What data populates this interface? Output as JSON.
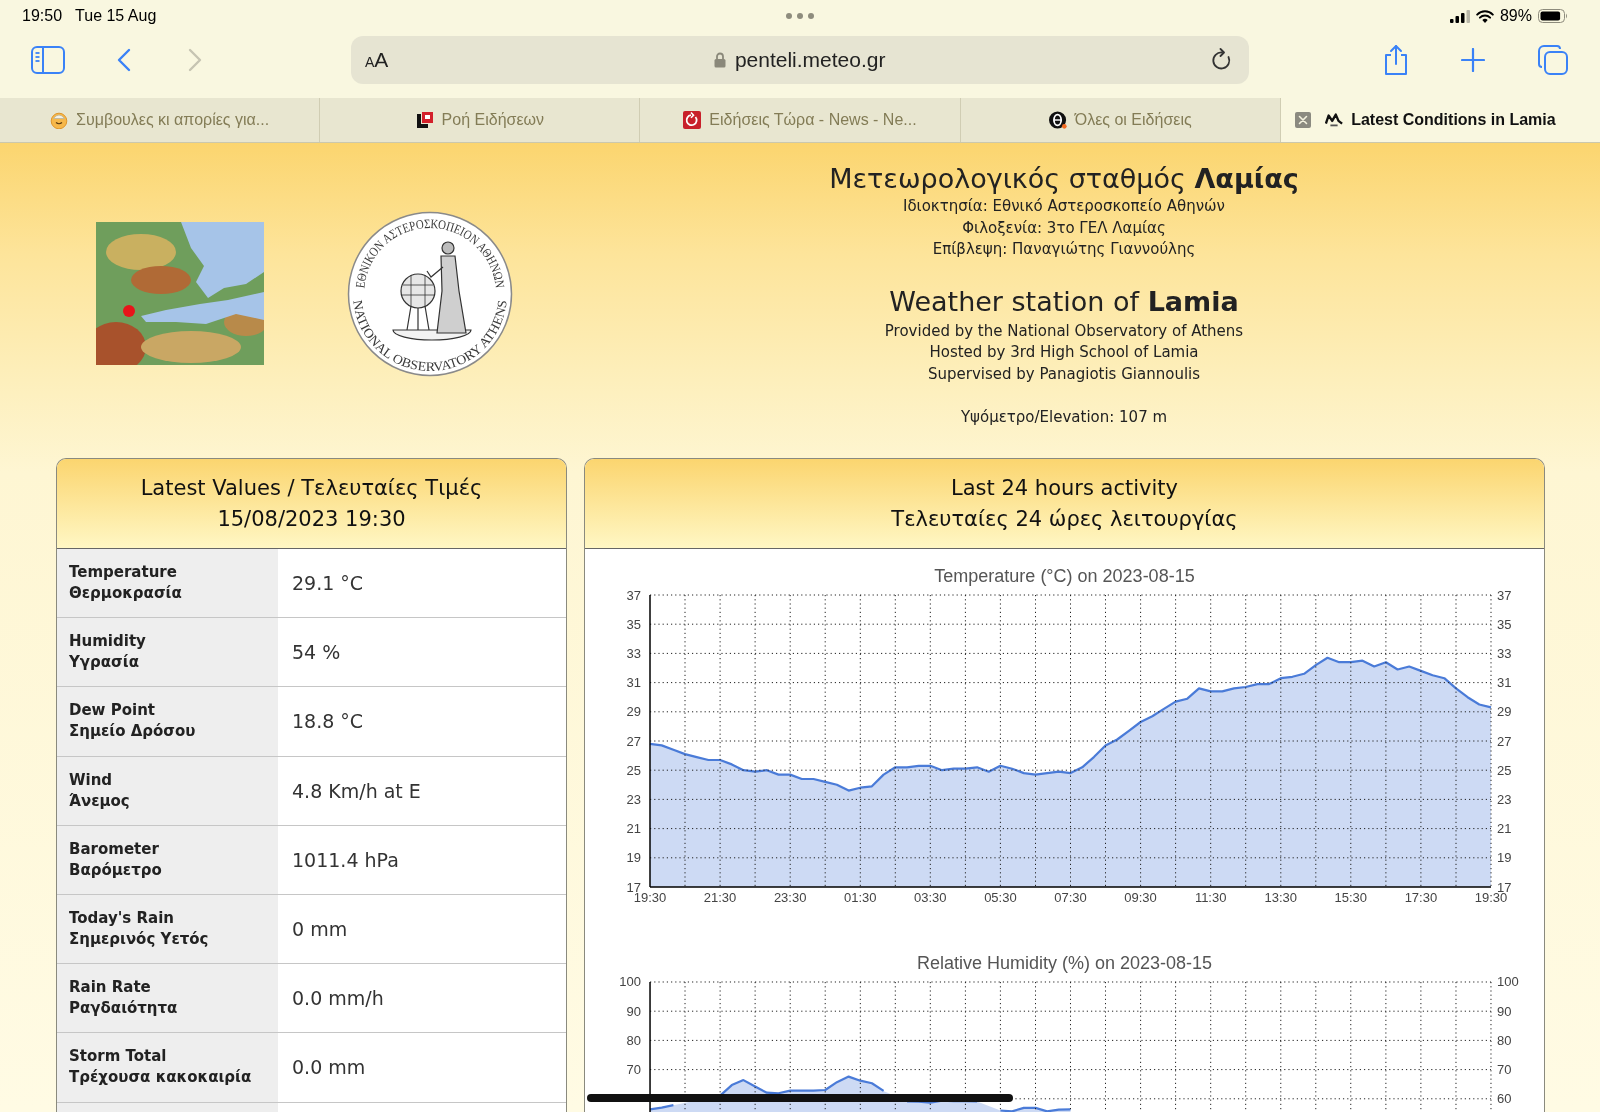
{
  "status_bar": {
    "time": "19:50",
    "date": "Tue 15 Aug",
    "battery": "89%"
  },
  "toolbar": {
    "back": {
      "disabled": false
    },
    "forward": {
      "disabled": true
    },
    "address": {
      "text_size": "AA",
      "url": "penteli.meteo.gr"
    }
  },
  "tabs": [
    {
      "kind": "smiley",
      "title": "Συμβουλες κι απορίες για...",
      "selected": false
    },
    {
      "kind": "block",
      "title": "Ροή Ειδήσεων",
      "selected": false
    },
    {
      "kind": "square",
      "title": "Ειδήσεις Τώρα - News - Ne...",
      "selected": false
    },
    {
      "kind": "circle",
      "title": "Όλες οι Ειδήσεις",
      "selected": false
    },
    {
      "kind": "zigzag",
      "title": "Latest Conditions in Lamia",
      "selected": true
    }
  ],
  "header": {
    "logo": {
      "top_text": "ΕΘΝΙΚΟΝ ΑΣΤΕΡΟΣΚΟΠΕΙΟΝ ΑΘΗΝΩΝ",
      "bottom_text": "NATIONAL OBSERVATORY ATHENS"
    },
    "greek": {
      "title": "Μετεωρολογικός σταθμός **Λαμίας**",
      "lines": [
        "Ιδιοκτησία: Εθνικό Αστεροσκοπείο Αθηνών",
        "Φιλοξενία: 3το ΓΕΛ Λαμίας",
        "Επίβλεψη: Παναγιώτης Γιαννούλης"
      ]
    },
    "english": {
      "title": "Weather station of **Lamia**",
      "lines": [
        "Provided by the National Observatory of Athens",
        "Hosted by 3rd High School of Lamia",
        "Supervised by Panagiotis Giannoulis"
      ]
    },
    "elevation": "Υψόμετρο/Elevation: 107 m"
  },
  "latest_values": {
    "title": "Latest Values / Τελευταίες Τιμές",
    "timestamp": "15/08/2023 19:30",
    "rows": [
      {
        "label": "Temperature",
        "label_gr": "Θερμοκρασία",
        "value": "29.1 °C"
      },
      {
        "label": "Humidity",
        "label_gr": "Υγρασία",
        "value": "54 %"
      },
      {
        "label": "Dew Point",
        "label_gr": "Σημείο Δρόσου",
        "value": "18.8 °C"
      },
      {
        "label": "Wind",
        "label_gr": "Άνεμος",
        "value": "4.8 Km/h at E"
      },
      {
        "label": "Barometer",
        "label_gr": "Βαρόμετρο",
        "value": "1011.4 hPa"
      },
      {
        "label": "Today's Rain",
        "label_gr": "Σημερινός Υετός",
        "value": "0 mm"
      },
      {
        "label": "Rain Rate",
        "label_gr": "Ραγδαιότητα",
        "value": "0.0 mm/h"
      },
      {
        "label": "Storm Total",
        "label_gr": "Τρέχουσα κακοκαιρία",
        "value": "0.0 mm"
      }
    ]
  },
  "activity": {
    "title": "Last 24 hours activity",
    "title_gr": "Τελευταίες 24 ώρες λειτουργίας",
    "charts": [
      {
        "chart_data": {
          "type": "area",
          "title": "Temperature (°C) on 2023-08-15",
          "categories": [
            "19:30",
            null,
            null,
            null,
            null,
            null,
            "21:30",
            null,
            null,
            null,
            null,
            null,
            "23:30",
            null,
            null,
            null,
            null,
            null,
            "01:30",
            null,
            null,
            null,
            null,
            null,
            "03:30",
            null,
            null,
            null,
            null,
            null,
            "05:30",
            null,
            null,
            null,
            null,
            null,
            "07:30",
            null,
            null,
            null,
            null,
            null,
            "09:30",
            null,
            null,
            null,
            null,
            null,
            "11:30",
            null,
            null,
            null,
            null,
            null,
            "13:30",
            null,
            null,
            null,
            null,
            null,
            "15:30",
            null,
            null,
            null,
            null,
            null,
            "17:30",
            null,
            null,
            null,
            null,
            null,
            "19:30"
          ],
          "series": [
            {
              "color": "#4a7bd8",
              "values": [
                26.8,
                26.7,
                26.4,
                26.1,
                25.9,
                25.7,
                25.7,
                25.4,
                25.0,
                24.9,
                25.0,
                24.7,
                24.7,
                24.4,
                24.4,
                24.2,
                24.0,
                23.6,
                23.8,
                23.9,
                24.7,
                25.2,
                25.2,
                25.3,
                25.3,
                25.0,
                25.1,
                25.1,
                25.2,
                24.9,
                25.3,
                25.1,
                24.8,
                24.7,
                24.8,
                24.9,
                24.8,
                25.2,
                25.9,
                26.7,
                27.1,
                27.7,
                28.3,
                28.7,
                29.2,
                29.7,
                29.9,
                30.6,
                30.4,
                30.4,
                30.6,
                30.7,
                30.9,
                30.9,
                31.3,
                31.4,
                31.6,
                32.2,
                32.7,
                32.4,
                32.4,
                32.5,
                32.1,
                32.4,
                31.9,
                32.1,
                31.8,
                31.5,
                31.3,
                30.6,
                30.0,
                29.5,
                29.3
              ]
            }
          ],
          "ylim": [
            17,
            37
          ],
          "yticks": [
            17,
            19,
            21,
            23,
            25,
            27,
            29,
            31,
            33,
            35,
            37
          ],
          "grid": true
        },
        "left_axis_labels": [
          "37",
          "35",
          "33",
          "31",
          "29",
          "27",
          "25",
          "23",
          "21",
          "19",
          "17"
        ],
        "right_axis_labels": [
          "37",
          "35",
          "33",
          "31",
          "29",
          "27",
          "25",
          "23",
          "21",
          "19",
          "17"
        ]
      },
      {
        "chart_data": {
          "type": "area",
          "title": "Relative Humidity (%) on 2023-08-15",
          "categories": [
            null,
            null,
            null,
            null,
            null,
            null,
            null,
            null,
            null,
            null,
            null,
            null,
            null,
            null,
            null,
            null,
            null,
            null,
            null,
            null,
            null,
            null,
            null,
            null,
            null,
            null,
            null,
            null,
            null,
            null,
            null,
            null,
            null,
            null,
            null,
            null,
            null,
            null,
            null,
            null,
            null,
            null,
            null,
            null,
            null,
            null,
            null,
            null,
            null,
            null,
            null,
            null,
            null,
            null,
            null,
            null,
            null,
            null,
            null,
            null,
            null,
            null,
            null,
            null,
            null,
            null,
            null,
            null,
            null,
            null,
            null,
            null,
            null
          ],
          "series": [
            {
              "color": "#4a7bd8",
              "values": [
                56.4,
                57.0,
                57.8,
                null,
                null,
                null,
                61.1,
                64.7,
                66.4,
                64.2,
                62.1,
                61.9,
                62.8,
                62.8,
                62.8,
                63.0,
                65.7,
                67.6,
                66.2,
                65.3,
                62.7,
                null,
                59.1,
                59.0,
                58.7,
                59.4,
                59.2,
                59.2,
                59.1,
                null,
                56.0,
                55.7,
                56.9,
                56.9,
                55.7,
                56.3,
                56.4,
                null,
                null,
                null,
                null,
                null,
                null,
                null,
                null,
                null,
                null,
                null,
                null,
                null,
                null,
                null,
                null,
                null,
                null,
                null,
                null,
                null,
                null,
                null,
                null,
                null,
                null,
                null,
                null,
                null,
                null,
                null,
                null,
                null,
                null,
                null,
                null
              ]
            }
          ],
          "ylim": [
            55,
            100
          ],
          "yticks": [
            60,
            70,
            80,
            90,
            100
          ],
          "grid": true
        },
        "left_axis_labels": [
          "100",
          "90",
          "80",
          "70"
        ],
        "right_axis_labels": [
          "100",
          "90",
          "80",
          "70",
          "60"
        ]
      }
    ]
  }
}
